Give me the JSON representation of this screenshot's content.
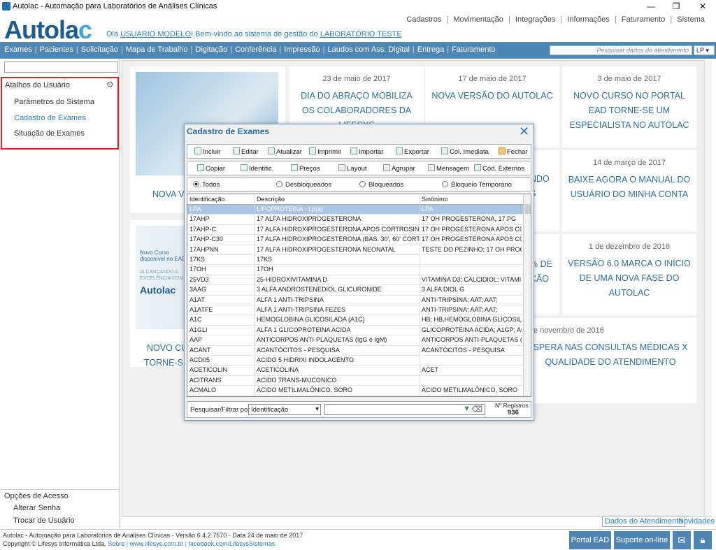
{
  "window": {
    "title": "Autolac - Automação para Laboratórios de Análises Clínicas"
  },
  "header": {
    "logo": "Autolac",
    "welcome_pre": "Olá ",
    "user": "USUARIO MODELO",
    "welcome_mid": "! Bem-vindo ao sistema de gestão do ",
    "lab": "LABORATÓRIO TESTE",
    "top_nav": [
      "Cadastros",
      "Movimentação",
      "Integrações",
      "Informações",
      "Faturamento",
      "Sistema"
    ]
  },
  "menu": {
    "items": [
      "Exames",
      "Pacientes",
      "Solicitação",
      "Mapa de Trabalho",
      "Digitação",
      "Conferência",
      "Impressão",
      "Laudos com Ass. Digital",
      "Entrega",
      "Faturamento"
    ],
    "search_placeholder": "Pesquisar dados do atendimento",
    "search_mode": "LP"
  },
  "sidebar": {
    "shortcuts_title": "Atalhos do Usuário",
    "shortcuts": [
      "Parâmetros do Sistema",
      "Cadastro de Exames",
      "Situação de Exames"
    ],
    "access_title": "Opções de Acesso",
    "access": [
      "Alterar Senha",
      "Trocar de Usuário"
    ]
  },
  "news": [
    {
      "date": "23 de maio de 2017",
      "text": "DIA DO ABRAÇO MOBILIZA OS COLABORADORES DA LIFESYS"
    },
    {
      "date": "17 de maio de 2017",
      "text": "NOVA VERSÃO DO AUTOLAC"
    },
    {
      "date": "3 de maio de 2017",
      "text": "NOVO CURSO NO PORTAL EAD TORNE-SE UM ESPECIALISTA NO AUTOLAC"
    },
    {
      "date": "14 de março de 2017",
      "text": "BAIXE AGORA O MANUAL DO USUÁRIO DO MINHA CONTA"
    },
    {
      "date": "1 de dezembro de 2016",
      "text": "VERSÃO 6.0 MARCA O INÍCIO DE UMA NOVA FASE DO AUTOLAC"
    },
    {
      "date": "e novembro de 2016",
      "text": "SPERA NAS CONSULTAS MÉDICAS X QUALIDADE DO ATENDIMENTO"
    }
  ],
  "news_partial": {
    "left1": "NOVA V",
    "left2_line1": "NOVO CU",
    "left2_line2": "TORNE-SE",
    "mid_a": "NDO",
    "mid_b": "S",
    "mid_c": "% DE",
    "mid_d": "ÇÃO",
    "ad_line1": "Novo Curso",
    "ad_line2": "disponível no EAD",
    "ad_line3": "ALCANÇANDO A",
    "ad_line4": "EXCELÊNCIA COM O",
    "ad_logo": "Autolac"
  },
  "content_tabs": [
    "Dados do Atendimento",
    "Novidades"
  ],
  "modal": {
    "title": "Cadastro de Exames",
    "toolbar1": [
      "Incluir",
      "Editar",
      "Atualizar",
      "Imprimir",
      "Importar",
      "Exportar",
      "Col. Imediata",
      "Fechar"
    ],
    "toolbar2": [
      "Copiar",
      "Identific.",
      "Preços",
      "Layout",
      "Agrupar",
      "Mensagem",
      "Cód. Externos"
    ],
    "filters": [
      "Todos",
      "Desbloqueados",
      "Bloqueados",
      "Bloqueio Temporário"
    ],
    "selected_filter": "Todos",
    "columns": [
      "Identificação",
      "Descrição",
      "Sinônimo"
    ],
    "rows": [
      [
        "LPA",
        "LIPOPROTEÍNA - Lp(a)",
        "LPA"
      ],
      [
        "17AHP",
        "17 ALFA HIDROXIPROGESTERONA",
        "17 OH PROGESTERONA, 17 PG"
      ],
      [
        "17AHP-C",
        "17 ALFA HIDROXIPROGESTERONA APOS CORTROSINA (ACT",
        "17 OH PROGESTERONA APOS CORT"
      ],
      [
        "17AHP-C30",
        "17 ALFA HIDROXIPROGESTERONA (BAS. 30', 60' CORTROSI",
        "17 OH PROGESTERONA APOS CORT"
      ],
      [
        "17AHPNN",
        "17 ALFA HIDROXIPROGESTERONA NEONATAL",
        "TESTE DO PEZINHO; 17 OH PROGES"
      ],
      [
        "17KS",
        "17KS",
        ""
      ],
      [
        "17OH",
        "17OH",
        ""
      ],
      [
        "25VD3",
        "25-HIDROXIVITAMINA D",
        "VITAMINA D3; CALCIDIOL; VITAMI"
      ],
      [
        "3AAG",
        "3 ALFA ANDROSTENEDIOL GLICURONIDE",
        "3 ALFA DIOL G"
      ],
      [
        "A1AT",
        "ALFA 1 ANTI-TRIPSINA",
        "ANTI-TRIPSINA; AAT; AAT;"
      ],
      [
        "A1ATFE",
        "ALFA 1 ANTI-TRIPSINA FEZES",
        "ANTI-TRIPSINA; AAT; AAT;"
      ],
      [
        "A1C",
        "HEMOGLOBINA GLICOSILADA (A1C)",
        "HB; HB,HEMOGLOBINA GLICOSILADA"
      ],
      [
        "A1GLI",
        "ALFA 1 GLICOPROTEINA ACIDA",
        "GLICOPROTEINA ACIDA; A1GP; AGP"
      ],
      [
        "AAP",
        "ANTICORPOS ANTI-PLAQUETAS (IgG e IgM)",
        "ANTICORPOS ANTI-PLAQUETAS (IgG"
      ],
      [
        "ACANT",
        "ACANTÓCITOS - PESQUISA",
        "ACANTÓCITOS - PESQUISA"
      ],
      [
        "ACD05",
        "ACIDO 5 HIDRIXI INDOLACENTO",
        ""
      ],
      [
        "ACETICOLIN",
        "ACETICOLINA",
        "ACET"
      ],
      [
        "ACITRANS",
        "ACIDO TRANS-MUCONICO",
        ""
      ],
      [
        "ACMALO",
        "ÁCIDO METILMALÔNICO, SORO",
        "ÁCIDO METILMALÔNICO, SORO"
      ]
    ],
    "filter_label": "Pesquisar/Filtrar por",
    "filter_field": "Identificação",
    "filter_value": "",
    "records_label": "Nº Registros",
    "records_count": "936"
  },
  "footer": {
    "line1": "Autolac - Automação para Laboratórios de Análises Clínicas - Versão 6.4.2.7570 - Data 24 de maio de 2017",
    "line2": "Copyright © Lifesys Informática Ltda.",
    "link_sobre": "Sobre",
    "link_site": "www.lifesys.com.br",
    "link_fb": "facebook.com/LifesysSistemas",
    "btn_portal": "Portal EAD",
    "btn_suporte": "Suporte on-line"
  }
}
